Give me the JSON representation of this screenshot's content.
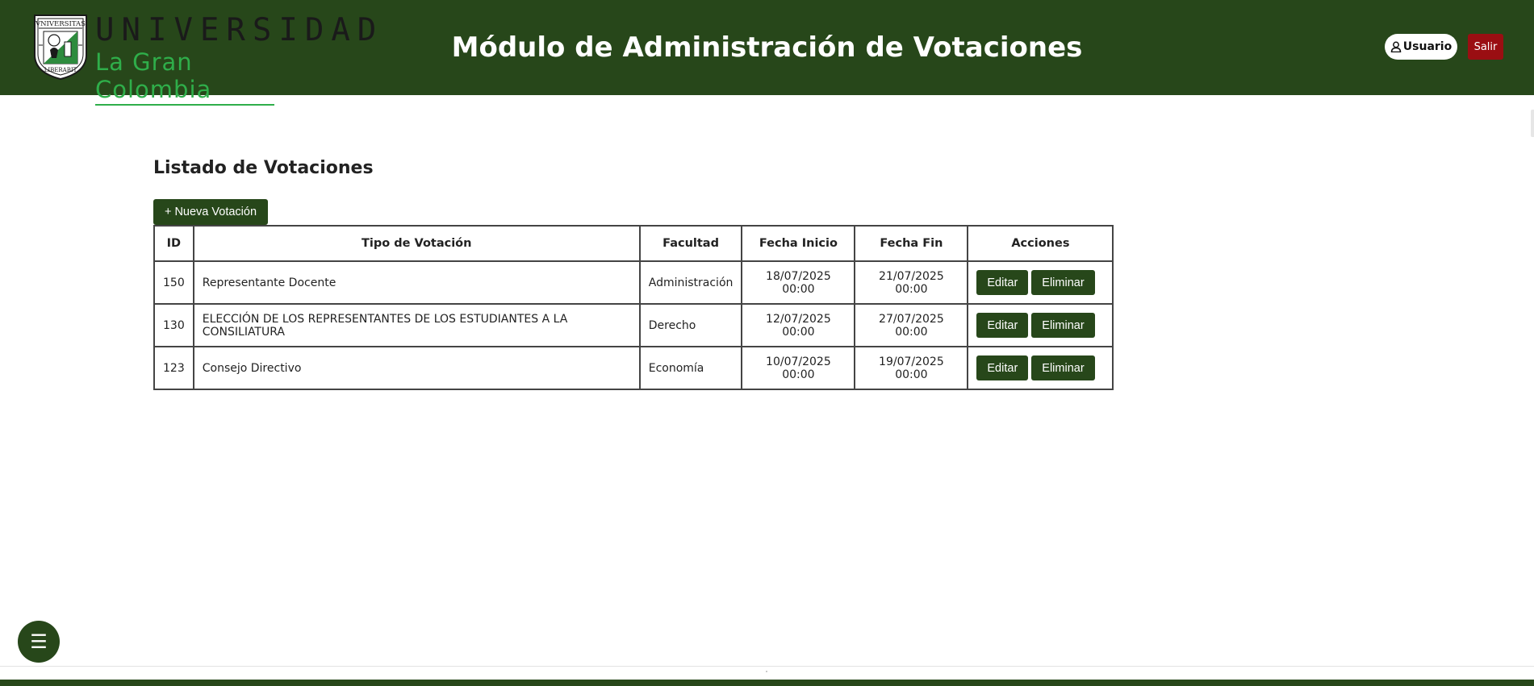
{
  "header": {
    "brand_top": "UNIVERSIDAD",
    "brand_bottom": "La Gran Colombia",
    "crest_text": [
      "VNIVERSITAS",
      "LIBERABIT"
    ],
    "title": "Módulo de Administración de Votaciones",
    "user_label": "Usuario",
    "logout_label": "Salir"
  },
  "main": {
    "section_title": "Listado de Votaciones",
    "new_button_label": "+ Nueva Votación",
    "table": {
      "headers": [
        "ID",
        "Tipo de Votación",
        "Facultad",
        "Fecha Inicio",
        "Fecha Fin",
        "Acciones"
      ],
      "rows": [
        {
          "id": "150",
          "tipo": "Representante Docente",
          "facultad": "Administración",
          "inicio": "18/07/2025 00:00",
          "fin": "21/07/2025 00:00"
        },
        {
          "id": "130",
          "tipo": "ELECCIÓN DE LOS REPRESENTANTES DE LOS ESTUDIANTES A LA CONSILIATURA",
          "facultad": "Derecho",
          "inicio": "12/07/2025 00:00",
          "fin": "27/07/2025 00:00"
        },
        {
          "id": "123",
          "tipo": "Consejo Directivo",
          "facultad": "Economía",
          "inicio": "10/07/2025 00:00",
          "fin": "19/07/2025 00:00"
        }
      ],
      "edit_label": "Editar",
      "delete_label": "Eliminar"
    }
  },
  "fab": {
    "icon": "☰"
  },
  "colors": {
    "brand_green": "#27471a",
    "brand_light_green": "#2fae4a",
    "danger": "#9a0e12"
  }
}
